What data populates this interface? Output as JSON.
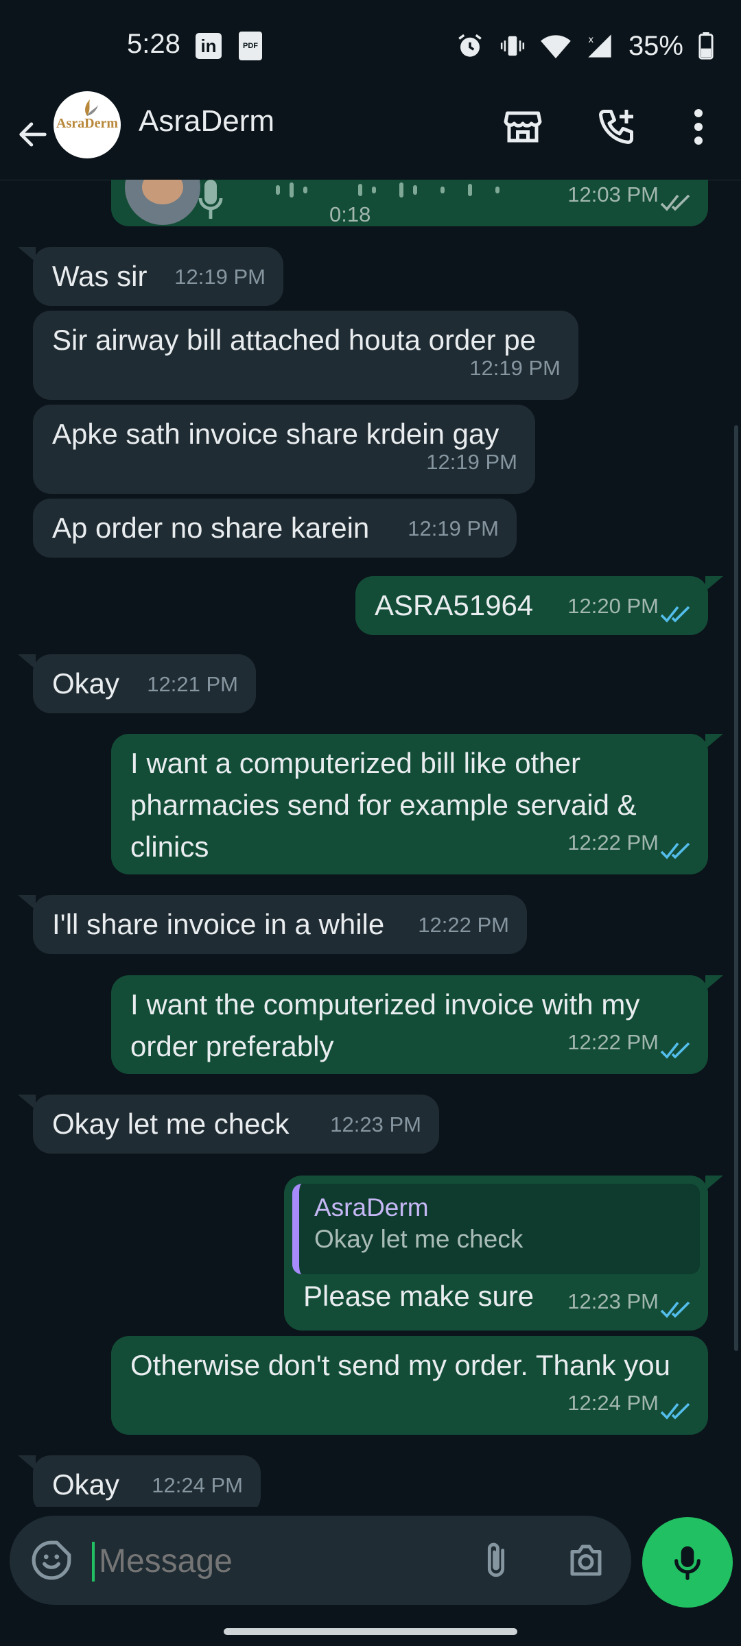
{
  "status_bar": {
    "time": "5:28",
    "linkedin": "in",
    "pdf": "PDF",
    "battery": "35%"
  },
  "header": {
    "title": "AsraDerm",
    "avatar_text": "AsraDerm"
  },
  "messages": {
    "voice": {
      "duration": "0:18",
      "time": "12:03 PM"
    },
    "m1": {
      "text": "Was sir",
      "time": "12:19 PM"
    },
    "m2": {
      "text": "Sir airway bill attached houta order pe",
      "time": "12:19 PM"
    },
    "m3": {
      "text": "Apke sath invoice share krdein gay",
      "time": "12:19 PM"
    },
    "m4": {
      "text": "Ap order no share karein",
      "time": "12:19 PM"
    },
    "m5": {
      "text": "ASRA51964",
      "time": "12:20 PM"
    },
    "m6": {
      "text": "Okay",
      "time": "12:21 PM"
    },
    "m7": {
      "text": "I want a computerized bill like other pharmacies send for example servaid & clinics",
      "time": "12:22 PM"
    },
    "m8": {
      "text": "I'll share invoice in a while",
      "time": "12:22 PM"
    },
    "m9": {
      "text": "I want the computerized invoice with my order preferably",
      "time": "12:22 PM"
    },
    "m10": {
      "text": "Okay let me check",
      "time": "12:23 PM"
    },
    "m11": {
      "quote_name": "AsraDerm",
      "quote_text": "Okay let me check",
      "text": "Please make sure",
      "time": "12:23 PM"
    },
    "m12": {
      "text": "Otherwise don't send my order. Thank you",
      "time": "12:24 PM"
    },
    "m13": {
      "text": "Okay",
      "time": "12:24 PM"
    }
  },
  "composer": {
    "placeholder": "Message"
  },
  "colors": {
    "background": "#0b141a",
    "incoming": "#202c33",
    "outgoing": "#134d37",
    "read_ticks": "#53bdeb",
    "mic": "#21c063"
  }
}
